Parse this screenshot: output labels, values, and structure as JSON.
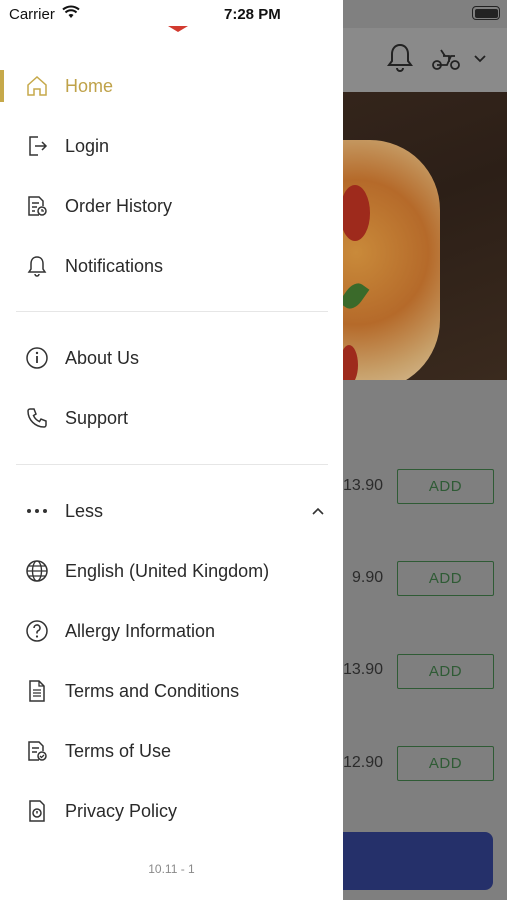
{
  "status_bar": {
    "carrier": "Carrier",
    "time": "7:28 PM"
  },
  "menu": {
    "primary": [
      {
        "label": "Home",
        "icon": "home-icon",
        "active": true
      },
      {
        "label": "Login",
        "icon": "login-icon"
      },
      {
        "label": "Order History",
        "icon": "order-history-icon"
      },
      {
        "label": "Notifications",
        "icon": "bell-icon"
      }
    ],
    "secondary": [
      {
        "label": "About Us",
        "icon": "info-icon"
      },
      {
        "label": "Support",
        "icon": "phone-icon"
      }
    ],
    "more": {
      "label": "Less",
      "icon": "more-dots-icon",
      "expanded": true
    },
    "extra": [
      {
        "label": "English (United Kingdom)",
        "icon": "globe-icon"
      },
      {
        "label": "Allergy Information",
        "icon": "question-icon"
      },
      {
        "label": "Terms and Conditions",
        "icon": "document-icon"
      },
      {
        "label": "Terms of Use",
        "icon": "document-check-icon"
      },
      {
        "label": "Privacy Policy",
        "icon": "privacy-icon"
      }
    ],
    "version": "10.11 - 1"
  },
  "background": {
    "products": [
      {
        "price": "13.90",
        "button": "ADD"
      },
      {
        "price": "9.90",
        "button": "ADD"
      },
      {
        "price": "13.90",
        "button": "ADD"
      },
      {
        "price": "12.90",
        "button": "ADD"
      }
    ]
  },
  "colors": {
    "accent": "#C6A94A",
    "add_green": "#2F5B35",
    "checkout": "#25306A",
    "logo_red": "#D23A2F"
  }
}
